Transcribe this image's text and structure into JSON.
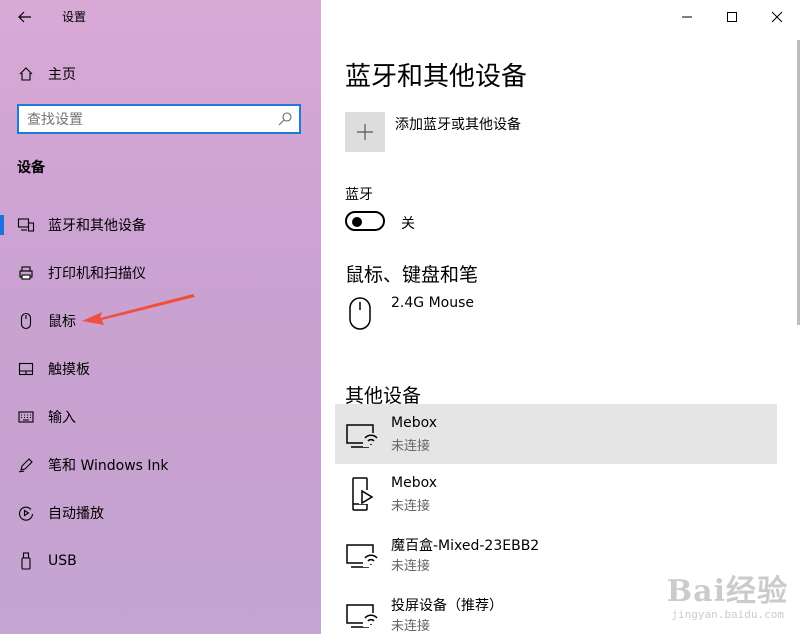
{
  "window": {
    "title": "设置"
  },
  "sidebar": {
    "home_label": "主页",
    "search": {
      "placeholder": "查找设置"
    },
    "section_title": "设备",
    "items": [
      {
        "label": "蓝牙和其他设备",
        "icon": "bluetooth-devices-icon",
        "selected": true
      },
      {
        "label": "打印机和扫描仪",
        "icon": "printer-icon",
        "selected": false
      },
      {
        "label": "鼠标",
        "icon": "mouse-icon",
        "selected": false
      },
      {
        "label": "触摸板",
        "icon": "touchpad-icon",
        "selected": false
      },
      {
        "label": "输入",
        "icon": "keyboard-icon",
        "selected": false
      },
      {
        "label": "笔和 Windows Ink",
        "icon": "pen-icon",
        "selected": false
      },
      {
        "label": "自动播放",
        "icon": "autoplay-icon",
        "selected": false
      },
      {
        "label": "USB",
        "icon": "usb-icon",
        "selected": false
      }
    ]
  },
  "main": {
    "title": "蓝牙和其他设备",
    "add_device_label": "添加蓝牙或其他设备",
    "bluetooth": {
      "label": "蓝牙",
      "state": "关"
    },
    "mouse_section": {
      "title": "鼠标、键盘和笔",
      "devices": [
        {
          "name": "2.4G Mouse",
          "icon": "mouse-icon"
        }
      ]
    },
    "other_section": {
      "title": "其他设备",
      "devices": [
        {
          "name": "Mebox",
          "status": "未连接",
          "icon": "network-display-icon"
        },
        {
          "name": "Mebox",
          "status": "未连接",
          "icon": "media-device-icon"
        },
        {
          "name": "魔百盒-Mixed-23EBB2",
          "status": "未连接",
          "icon": "network-display-icon"
        },
        {
          "name": "投屏设备（推荐）",
          "status": "未连接",
          "icon": "network-display-icon"
        }
      ]
    }
  },
  "watermark": {
    "brand": "Bai经验",
    "url": "jingyan.baidu.com"
  },
  "colors": {
    "accent": "#1a73d9",
    "annotation_arrow": "#f05040"
  }
}
